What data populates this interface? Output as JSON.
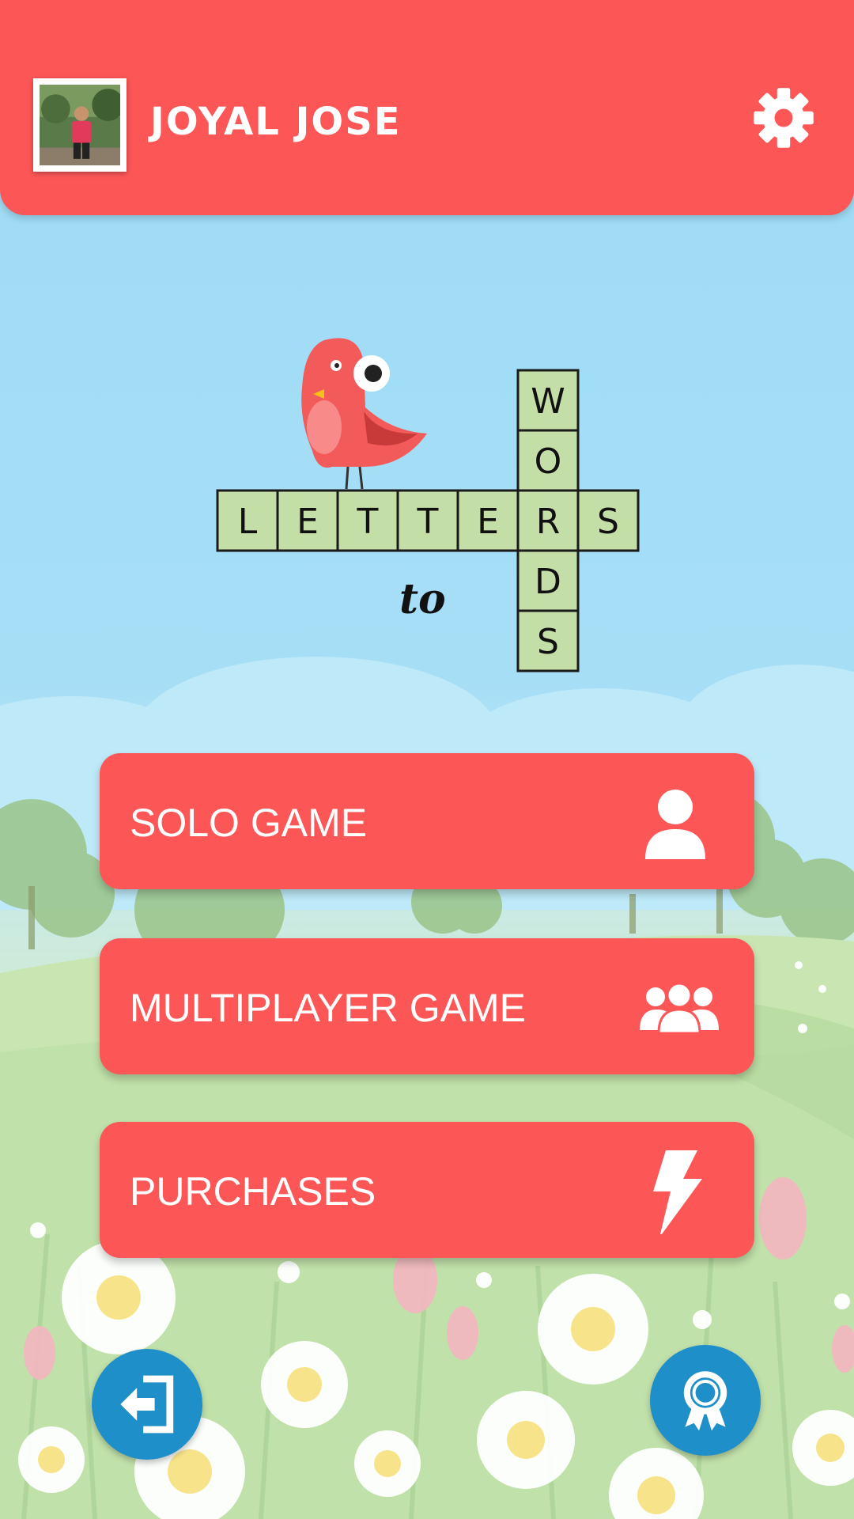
{
  "header": {
    "username": "JOYAL JOSE",
    "avatar_icon": "profile-photo",
    "settings_icon": "gear-icon"
  },
  "logo": {
    "across": [
      "L",
      "E",
      "T",
      "T",
      "E",
      "R",
      "S"
    ],
    "down": [
      "W",
      "O",
      "R",
      "D",
      "S"
    ],
    "connector": "to"
  },
  "menu": {
    "solo_label": "SOLO GAME",
    "multiplayer_label": "MULTIPLAYER GAME",
    "purchases_label": "PURCHASES"
  },
  "colors": {
    "accent": "#fd5656",
    "round_button": "#1f8fc9",
    "tile": "#c3dea6"
  }
}
